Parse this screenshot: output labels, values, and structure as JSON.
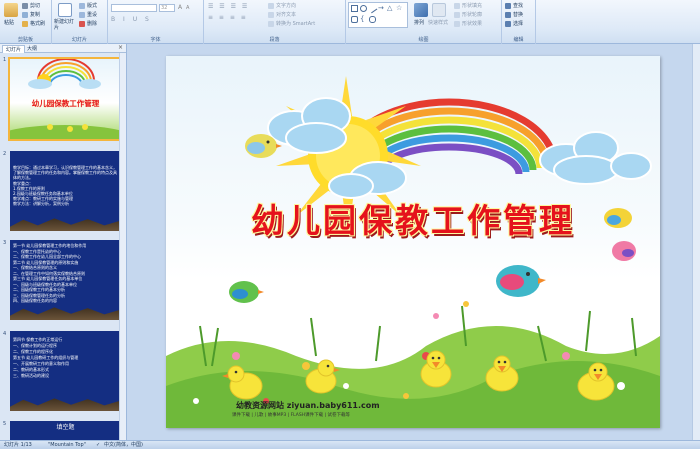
{
  "ribbon": {
    "clipboard": {
      "label": "剪贴板",
      "paste": "粘贴",
      "cut": "剪切",
      "copy": "复制",
      "format_painter": "格式刷"
    },
    "slides": {
      "label": "幻灯片",
      "new_slide": "新建幻灯片",
      "layout": "版式",
      "reset": "重设",
      "delete": "删除"
    },
    "font": {
      "label": "字体",
      "size": "32"
    },
    "paragraph": {
      "label": "段落",
      "text_direction": "文字方向",
      "align_text": "对齐文本",
      "smartart": "转换为 SmartArt"
    },
    "drawing": {
      "label": "绘图",
      "arrange": "排列",
      "quick_styles": "快速样式",
      "shape_fill": "形状填充",
      "shape_outline": "形状轮廓",
      "shape_effects": "形状效果"
    },
    "editing": {
      "label": "编辑",
      "find": "查找",
      "replace": "替换",
      "select": "选择"
    }
  },
  "panel": {
    "tab_slides": "幻灯片",
    "tab_outline": "大纲",
    "close": "×",
    "thumbs": [
      {
        "num": "1",
        "title": "幼儿园保教工作管理"
      },
      {
        "num": "2",
        "text": "教学目标：通过本章学习，认识保教管理工作的基本含义，了解保教管理工作的任务和内容。掌握保教工作的特点及具体的方法。\n教学重点：\n1.保教工作的原则\n2.园级与班级保教任务和基本单位\n教学难点：教研工作的实施与管理\n教学方法：讲解分析，案例分析"
      },
      {
        "num": "3",
        "text": "第一节 幼儿园保教管理工作的地位和作用\n一、保教工作是托幼的中心\n二、保教工作在幼儿园全部工作的中心\n第二节 幼儿园保教管理的原则和实施\n一、保教结合原则的含义\n二、在管理工作中如何落实保教结合原则\n第三节 幼儿园保教管理任务的基本单位\n一、园级与班级保教任务的基本单位\n二、园级保教工作的基本分析\n三、园级保教管理任务的分析\n四、园级保教任务的内容"
      },
      {
        "num": "4",
        "text": "第四节 保教工作的正常运行\n一、保教计划的运行程序\n二、保教工作的程序化\n第五节 幼儿园教研工作的组织与管理\n一、开展教研工作的意义和作用\n二、教研的基本形式\n三、教研活动的建设"
      },
      {
        "num": "5",
        "text": "填空题"
      }
    ]
  },
  "slide": {
    "title": "幼儿园保教工作管理",
    "site_line": "幼教资源网站 ziyuan.baby611.com",
    "site_sub": "课件下载 | 儿歌 | 故事MP3 | FLASH课件下载 | 试卷下载等"
  },
  "status": {
    "slide_info": "幻灯片 1/13",
    "theme": "\"Mountain Top\"",
    "language": "中文(简体，中国)"
  },
  "colors": {
    "title_red": "#e5121c",
    "ribbon_bg": "#dde9f7",
    "thumb_bg": "#142e82"
  }
}
